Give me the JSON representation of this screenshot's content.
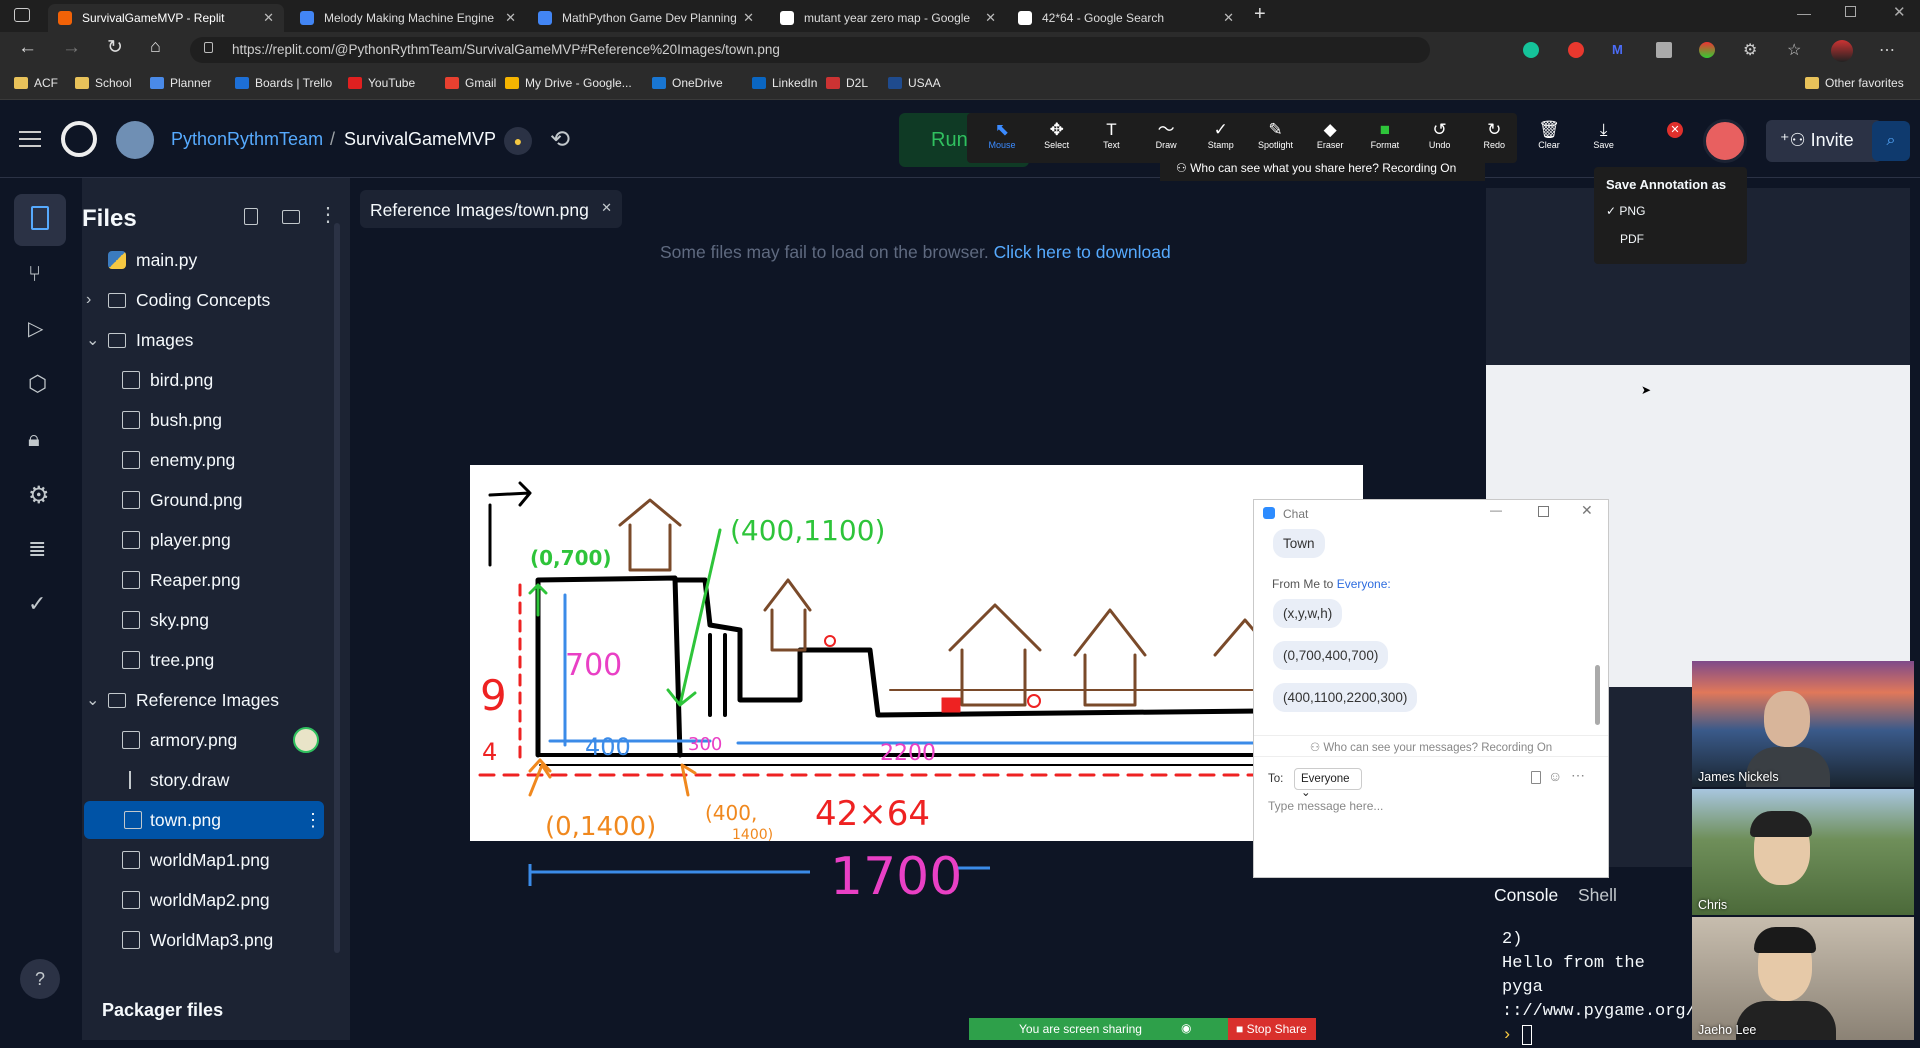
{
  "browser": {
    "tabs": [
      {
        "title": "SurvivalGameMVP - Replit",
        "active": true,
        "icon": "replit-icon",
        "color": "#f26207"
      },
      {
        "title": "Melody Making Machine Engine",
        "icon": "docs-icon",
        "color": "#4285f4"
      },
      {
        "title": "MathPython Game Dev Planning",
        "icon": "docs-icon",
        "color": "#4285f4"
      },
      {
        "title": "mutant year zero map - Google",
        "icon": "google-icon",
        "color": "#ffffff"
      },
      {
        "title": "42*64 - Google Search",
        "icon": "google-icon",
        "color": "#ffffff"
      }
    ],
    "url": "https://replit.com/@PythonRythmTeam/SurvivalGameMVP#Reference%20Images/town.png",
    "bookmarks": [
      "ACF",
      "School",
      "Planner",
      "Boards | Trello",
      "YouTube",
      "Gmail",
      "My Drive - Google...",
      "OneDrive",
      "LinkedIn",
      "D2L",
      "USAA"
    ],
    "other_favorites": "Other favorites"
  },
  "replit": {
    "team": "PythonRythmTeam",
    "separator": "/",
    "repl": "SurvivalGameMVP",
    "run_label": "Run",
    "invite_label": "Invite",
    "files_title": "Files",
    "file_tree": [
      {
        "name": "main.py",
        "type": "python",
        "indent": 0
      },
      {
        "name": "Coding Concepts",
        "type": "folder",
        "indent": 0,
        "chevron": "›"
      },
      {
        "name": "Images",
        "type": "folder",
        "indent": 0,
        "chevron": "⌄"
      },
      {
        "name": "bird.png",
        "type": "image",
        "indent": 1
      },
      {
        "name": "bush.png",
        "type": "image",
        "indent": 1
      },
      {
        "name": "enemy.png",
        "type": "image",
        "indent": 1
      },
      {
        "name": "Ground.png",
        "type": "image",
        "indent": 1
      },
      {
        "name": "player.png",
        "type": "image",
        "indent": 1
      },
      {
        "name": "Reaper.png",
        "type": "image",
        "indent": 1
      },
      {
        "name": "sky.png",
        "type": "image",
        "indent": 1
      },
      {
        "name": "tree.png",
        "type": "image",
        "indent": 1
      },
      {
        "name": "Reference Images",
        "type": "folder",
        "indent": 0,
        "chevron": "⌄"
      },
      {
        "name": "armory.png",
        "type": "image",
        "indent": 1
      },
      {
        "name": "story.draw",
        "type": "draw",
        "indent": 1
      },
      {
        "name": "town.png",
        "type": "image",
        "indent": 1,
        "selected": true
      },
      {
        "name": "worldMap1.png",
        "type": "image",
        "indent": 1
      },
      {
        "name": "worldMap2.png",
        "type": "image",
        "indent": 1
      },
      {
        "name": "WorldMap3.png",
        "type": "image",
        "indent": 1
      }
    ],
    "packager_files": "Packager files",
    "help": "?",
    "editor_tab": "Reference Images/town.png",
    "notice_text": "Some files may fail to load on the browser.",
    "notice_link": "Click here to download",
    "console_tab": "Console",
    "shell_tab": "Shell",
    "console_lines": [
      "2)",
      "Hello from the pyga",
      ":://www.pygame.org/c"
    ],
    "console_prompt": "›"
  },
  "drawing": {
    "labels": [
      "(0,700)",
      "(400,1100)",
      "700",
      "9",
      "4",
      "400",
      "300",
      "2200",
      "(0,1400)",
      "(400,",
      "1400)",
      "42×64",
      "1700"
    ]
  },
  "annotation": {
    "tools": [
      {
        "label": "Mouse",
        "glyph": "⬉",
        "active": true
      },
      {
        "label": "Select",
        "glyph": "✥"
      },
      {
        "label": "Text",
        "glyph": "T"
      },
      {
        "label": "Draw",
        "glyph": "〜"
      },
      {
        "label": "Stamp",
        "glyph": "✓"
      },
      {
        "label": "Spotlight",
        "glyph": "✎"
      },
      {
        "label": "Eraser",
        "glyph": "◆"
      },
      {
        "label": "Format",
        "glyph": "■"
      },
      {
        "label": "Undo",
        "glyph": "↺"
      },
      {
        "label": "Redo",
        "glyph": "↻"
      },
      {
        "label": "Clear",
        "glyph": "🗑"
      },
      {
        "label": "Save",
        "glyph": "⤓"
      }
    ],
    "recording_notice": "Who can see what you share here? Recording On",
    "save_menu": {
      "title": "Save Annotation as",
      "options": [
        "PNG",
        "PDF"
      ],
      "checked": "PNG"
    }
  },
  "chat": {
    "title": "Chat",
    "messages": [
      "Town",
      "(x,y,w,h)",
      "(0,700,400,700)",
      "(400,1100,2200,300)"
    ],
    "from_prefix": "From Me to ",
    "from_target": "Everyone:",
    "recording_notice": "Who can see your messages? Recording On",
    "to_label": "To:",
    "to_value": "Everyone",
    "input_placeholder": "Type message here..."
  },
  "video": {
    "participants": [
      "James Nickels",
      "Chris",
      "Jaeho Lee"
    ]
  },
  "share": {
    "status": "You are screen sharing",
    "stop": "Stop Share"
  }
}
